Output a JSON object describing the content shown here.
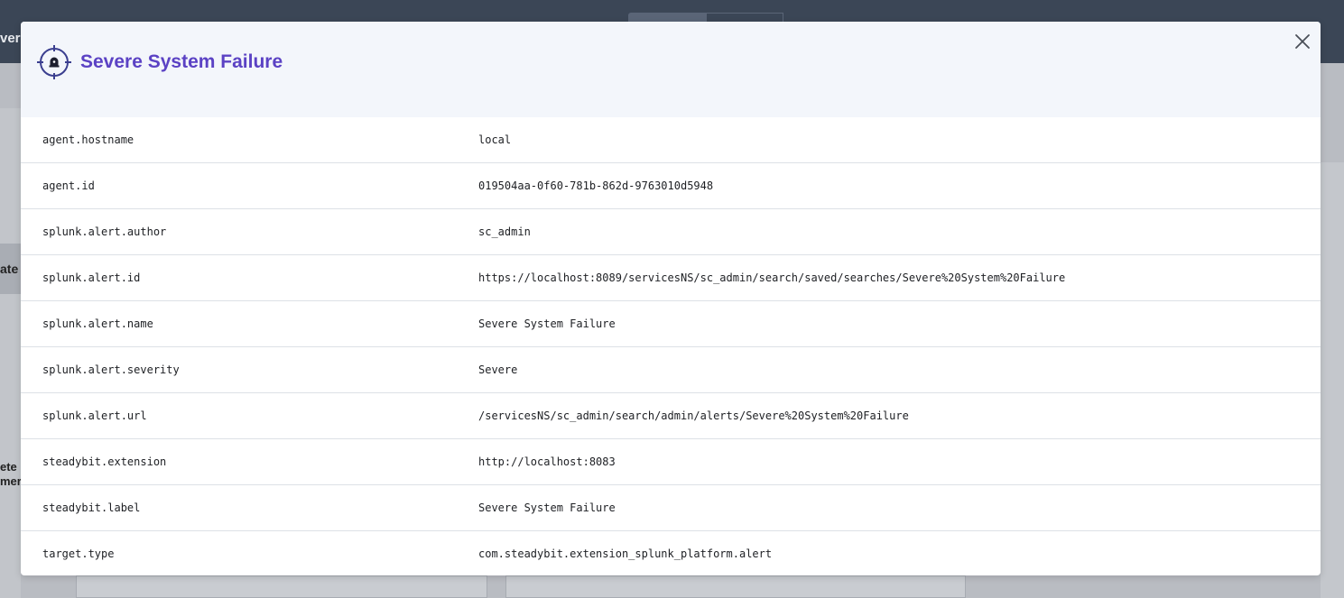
{
  "modal": {
    "title": "Severe System Failure",
    "icon": "target-alert-icon",
    "close_icon": "close-icon",
    "accent_color": "#5b42c4"
  },
  "background": {
    "peek_top": "ver",
    "peek_mid": "ate",
    "peek_low1": "ete",
    "peek_low2": "mer"
  },
  "attributes": [
    {
      "key": "agent.hostname",
      "value": "local"
    },
    {
      "key": "agent.id",
      "value": "019504aa-0f60-781b-862d-9763010d5948"
    },
    {
      "key": "splunk.alert.author",
      "value": "sc_admin"
    },
    {
      "key": "splunk.alert.id",
      "value": "https://localhost:8089/servicesNS/sc_admin/search/saved/searches/Severe%20System%20Failure"
    },
    {
      "key": "splunk.alert.name",
      "value": "Severe System Failure"
    },
    {
      "key": "splunk.alert.severity",
      "value": "Severe"
    },
    {
      "key": "splunk.alert.url",
      "value": "/servicesNS/sc_admin/search/admin/alerts/Severe%20System%20Failure"
    },
    {
      "key": "steadybit.extension",
      "value": "http://localhost:8083"
    },
    {
      "key": "steadybit.label",
      "value": "Severe System Failure"
    },
    {
      "key": "target.type",
      "value": "com.steadybit.extension_splunk_platform.alert"
    }
  ]
}
